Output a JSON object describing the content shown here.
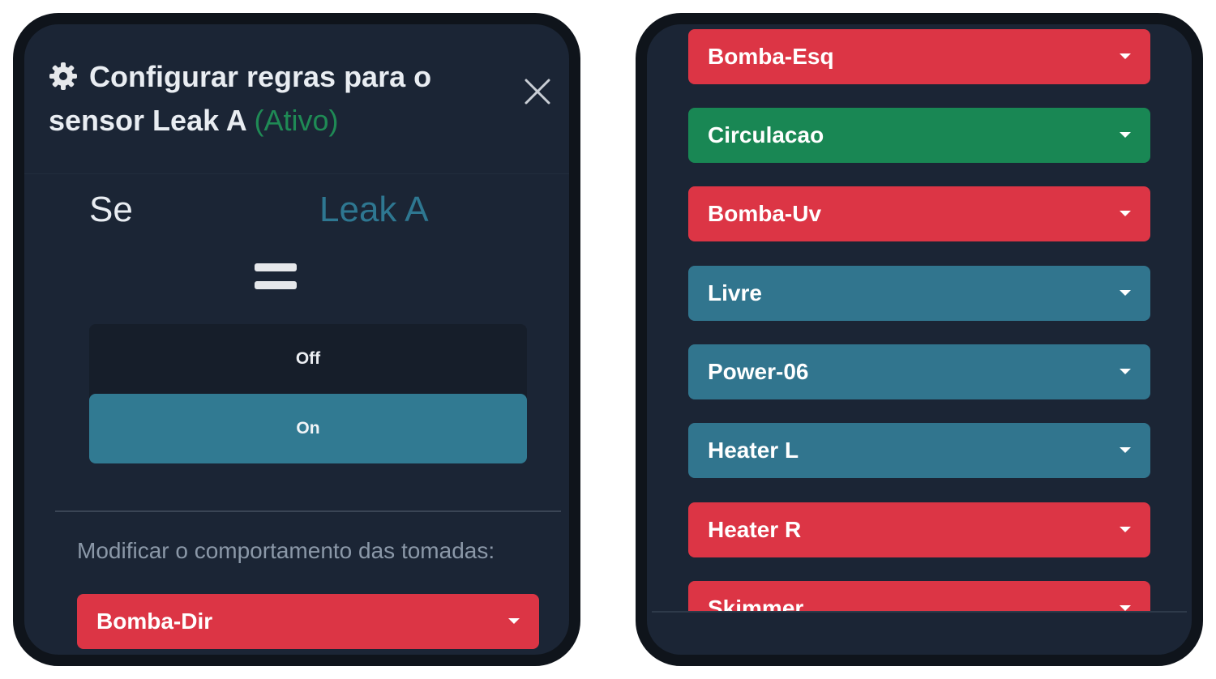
{
  "colors": {
    "red": "#dc3545",
    "green": "#198754",
    "teal": "#31758e",
    "panel": "#1b2535"
  },
  "modal": {
    "title_part1": "Configurar regras para o sensor Leak A",
    "title_status": "(Ativo)",
    "close_icon": "close-icon",
    "gear_icon": "gear-icon"
  },
  "rule": {
    "condition_label": "Se",
    "sensor_name": "Leak A",
    "operator_icon": "equals-icon",
    "options": [
      "Off",
      "On"
    ],
    "selected": "On"
  },
  "outlets_section": {
    "label": "Modificar o comportamento das tomadas:"
  },
  "left_outlets": [
    {
      "label": "Bomba-Dir",
      "color": "red"
    }
  ],
  "right_outlets": [
    {
      "label": "Bomba-Esq",
      "color": "red"
    },
    {
      "label": "Circulacao",
      "color": "green"
    },
    {
      "label": "Bomba-Uv",
      "color": "red"
    },
    {
      "label": "Livre",
      "color": "teal"
    },
    {
      "label": "Power-06",
      "color": "teal"
    },
    {
      "label": "Heater L",
      "color": "teal"
    },
    {
      "label": "Heater R",
      "color": "red"
    },
    {
      "label": "Skimmer",
      "color": "red"
    }
  ]
}
